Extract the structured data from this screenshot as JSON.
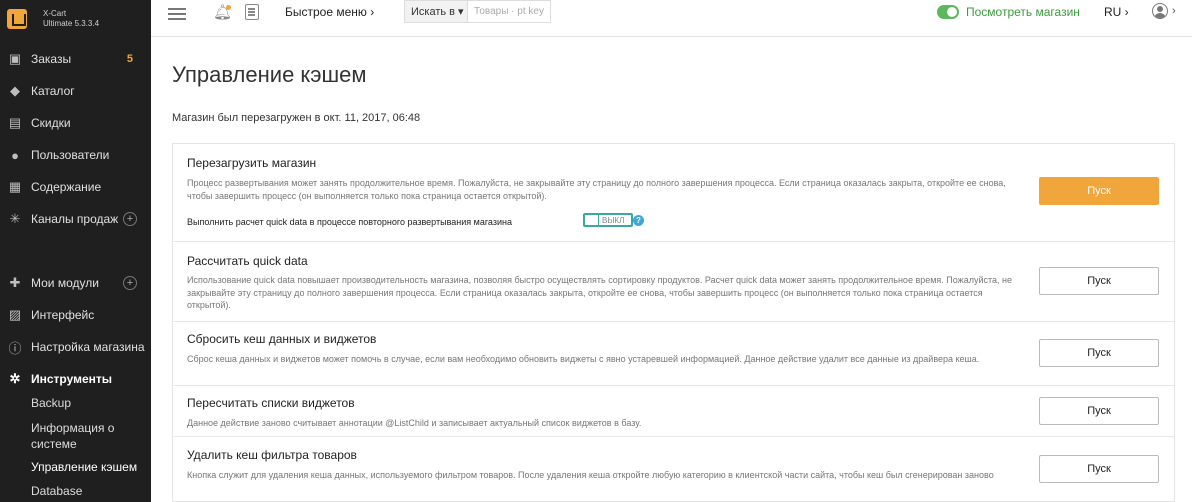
{
  "brand": {
    "name": "X-Cart",
    "version": "Ultimate 5.3.3.4"
  },
  "sidebar": {
    "items": [
      {
        "label": "Заказы",
        "icon": "orders-icon",
        "badge": "5"
      },
      {
        "label": "Каталог",
        "icon": "tag-icon"
      },
      {
        "label": "Скидки",
        "icon": "gift-icon"
      },
      {
        "label": "Пользователи",
        "icon": "users-icon"
      },
      {
        "label": "Содержание",
        "icon": "content-icon"
      },
      {
        "label": "Каналы продаж",
        "icon": "sales-channels-icon",
        "plus": "+"
      },
      {
        "label": "Мои модули",
        "icon": "puzzle-icon",
        "plus": "+"
      },
      {
        "label": "Интерфейс",
        "icon": "image-icon"
      },
      {
        "label": "Настройка магазина",
        "icon": "info-icon"
      },
      {
        "label": "Инструменты",
        "icon": "gear-icon"
      }
    ],
    "subitems": [
      "Backup",
      "Информация о системе",
      "Управление кэшем",
      "Database"
    ]
  },
  "topbar": {
    "quick_menu": "Быстрое меню ›",
    "search_scope": "Искать в ▾",
    "search_placeholder": "Товары · pt key",
    "view_store": "Посмотреть магазин",
    "lang": "RU ›",
    "user_chevron": "›"
  },
  "main": {
    "title": "Управление кэшем",
    "reloaded": "Магазин был перезагружен в окт. 11, 2017, 06:48",
    "rows": [
      {
        "title": "Перезагрузить магазин",
        "desc": "Процесс развертывания может занять продолжительное время. Пожалуйста, не закрывайте эту страницу до полного завершения процесса. Если страница оказалась закрыта, откройте ее снова, чтобы завершить процесс (он выполняется только пока страница остается открытой).",
        "option_label": "Выполнить расчет quick data в процессе повторного развертывания магазина",
        "switch_label": "ВЫКЛ",
        "button": "Пуск"
      },
      {
        "title": "Рассчитать quick data",
        "desc": "Использование quick data повышает производительность магазина, позволяя быстро осуществлять сортировку продуктов. Расчет quick data может занять продолжительное время. Пожалуйста, не закрывайте эту страницу до полного завершения процесса. Если страница оказалась закрыта, откройте ее снова, чтобы завершить процесс (он выполняется только пока страница остается открытой).",
        "button": "Пуск"
      },
      {
        "title": "Сбросить кеш данных и виджетов",
        "desc": "Сброс кеша данных и виджетов может помочь в случае, если вам необходимо обновить виджеты с явно устаревшей информацией. Данное действие удалит все данные из драйвера кеша.",
        "button": "Пуск"
      },
      {
        "title": "Пересчитать списки виджетов",
        "desc": "Данное действие заново считывает аннотации @ListChild и записывает актуальный список виджетов в базу.",
        "button": "Пуск"
      },
      {
        "title": "Удалить кеш фильтра товаров",
        "desc": "Кнопка служит для удаления кеша данных, используемого фильтром товаров. После удаления кеша откройте любую категорию в клиентской части сайта, чтобы кеш был сгенерирован заново",
        "button": "Пуск"
      }
    ]
  },
  "colors": {
    "accent": "#f0a63a",
    "sidebar_bg": "#1f1f1f",
    "success": "#5cb85c",
    "switch_border": "#3aa89f",
    "help": "#3ba7dd"
  }
}
